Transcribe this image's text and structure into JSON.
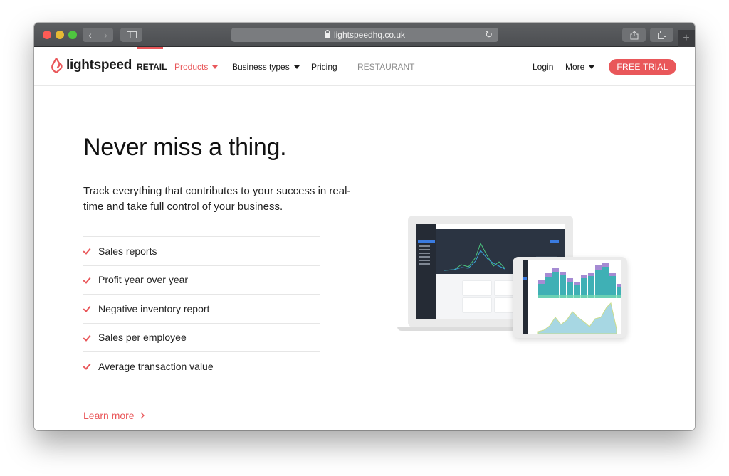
{
  "browser": {
    "url": "lightspeedhq.co.uk",
    "back_icon": "chevron-left-icon",
    "forward_icon": "chevron-right-icon",
    "sidebar_icon": "sidebar-icon",
    "reload_icon": "reload-icon",
    "share_icon": "share-icon",
    "tabs_icon": "tabs-icon",
    "new_tab_label": "+"
  },
  "nav": {
    "brand": "lightspeed",
    "items": [
      {
        "label": "RETAIL",
        "state": "active"
      },
      {
        "label": "Products",
        "state": "highlighted",
        "has_dropdown": true
      },
      {
        "label": "Business types",
        "has_dropdown": true
      },
      {
        "label": "Pricing"
      },
      {
        "label": "RESTAURANT",
        "state": "muted"
      }
    ],
    "login": "Login",
    "more": "More",
    "cta": "FREE TRIAL"
  },
  "hero": {
    "title": "Never miss a thing.",
    "subtitle": "Track everything that contributes to your success in real-time and take full control of your business.",
    "features": [
      "Sales reports",
      "Profit year over year",
      "Negative inventory report",
      "Sales per employee",
      "Average transaction value"
    ],
    "learn_more": "Learn more",
    "learn_more_icon": "chevron-right-icon"
  },
  "illustration": {
    "description": "Laptop and tablet showing Lightspeed analytics dashboard"
  },
  "colors": {
    "brand_red": "#e9575a",
    "titlebar": "#4c4e51",
    "text": "#1a1a1a"
  }
}
